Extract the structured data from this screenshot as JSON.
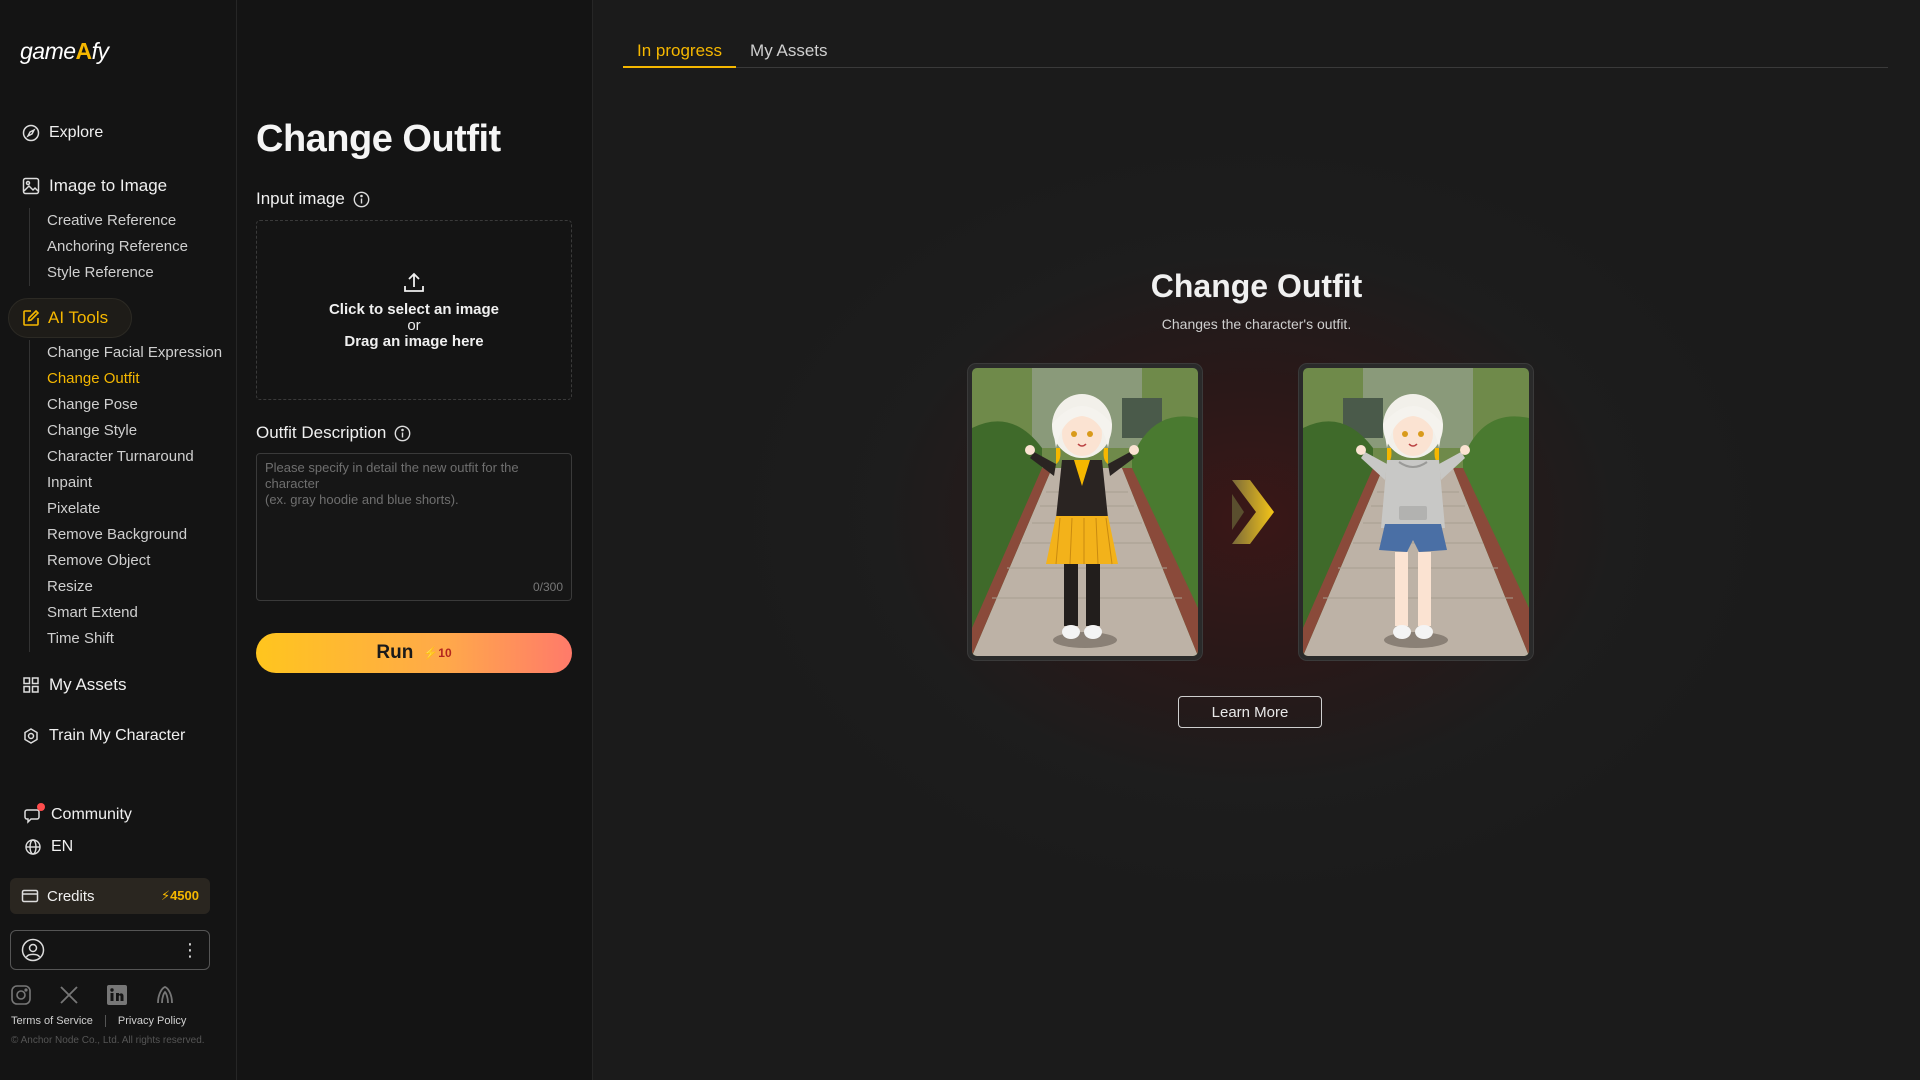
{
  "brand": {
    "logo_text_left": "game",
    "logo_text_mid": "A",
    "logo_text_right": "fy"
  },
  "sidebar": {
    "explore": "Explore",
    "image_to_image": "Image to Image",
    "image_to_image_items": [
      "Creative Reference",
      "Anchoring Reference",
      "Style Reference"
    ],
    "ai_tools": "AI Tools",
    "ai_tools_items": [
      "Change Facial Expression",
      "Change Outfit",
      "Change Pose",
      "Change Style",
      "Character Turnaround",
      "Inpaint",
      "Pixelate",
      "Remove Background",
      "Remove Object",
      "Resize",
      "Smart Extend",
      "Time Shift"
    ],
    "active_item": "Change Outfit",
    "my_assets": "My Assets",
    "train_my_character": "Train My Character",
    "community": "Community",
    "language": "EN",
    "credits_label": "Credits",
    "credits_amount": "4500",
    "terms": "Terms of Service",
    "privacy": "Privacy Policy",
    "copyright": "© Anchor Node Co., Ltd. All rights reserved."
  },
  "form": {
    "title": "Change Outfit",
    "input_image_label": "Input image",
    "upload_line1": "Click to select an image",
    "upload_line2": "or",
    "upload_line3": "Drag an image here",
    "outfit_label": "Outfit Description",
    "outfit_placeholder": "Please specify in detail the new outfit for the character\n(ex. gray hoodie and blue shorts).",
    "outfit_value": "",
    "counter": "0/300",
    "run_label": "Run",
    "run_cost": "10"
  },
  "main": {
    "tabs": [
      {
        "label": "In progress",
        "active": true
      },
      {
        "label": "My Assets",
        "active": false
      }
    ],
    "hero_title": "Change Outfit",
    "hero_subtitle": "Changes the character's outfit.",
    "learn_more": "Learn More"
  },
  "colors": {
    "accent": "#f5b700",
    "background": "#141414",
    "run_gradient_start": "#ffc51e",
    "run_gradient_end": "#ff7a6a"
  }
}
